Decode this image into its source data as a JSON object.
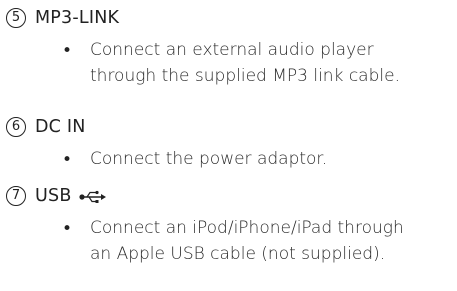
{
  "items": [
    {
      "number": "5",
      "title": "MP3-LINK",
      "bullet": "•",
      "text_lines": [
        "Connect an external audio player",
        "through the supplied MP3 link cable."
      ]
    },
    {
      "number": "6",
      "title": "DC IN",
      "bullet": "•",
      "text_lines": [
        "Connect the power adaptor."
      ]
    },
    {
      "number": "7",
      "title": "USB",
      "icon": "usb-icon",
      "bullet": "•",
      "text_lines": [
        "Connect an iPod/iPhone/iPad through",
        "an Apple USB cable (not supplied)."
      ]
    }
  ]
}
